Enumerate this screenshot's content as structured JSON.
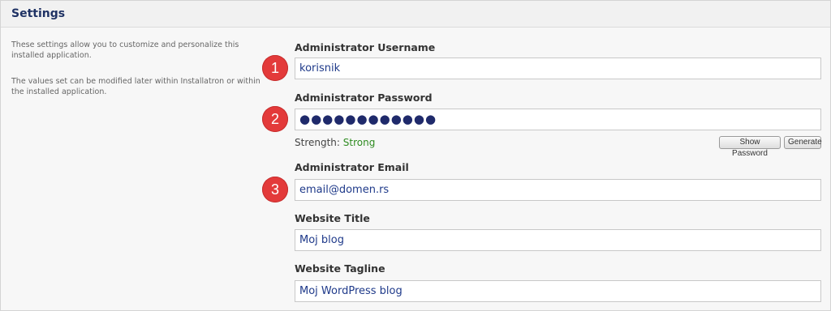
{
  "panel": {
    "title": "Settings"
  },
  "description": {
    "paragraph_1": "These settings allow you to customize and personalize this installed application.",
    "paragraph_2": "The values set can be modified later within Installatron or within the installed application."
  },
  "fields": {
    "username": {
      "label": "Administrator Username",
      "value": "korisnik",
      "marker": "1"
    },
    "password": {
      "label": "Administrator Password",
      "value": "●●●●●●●●●●●●",
      "marker": "2"
    },
    "email": {
      "label": "Administrator Email",
      "value": "email@domen.rs",
      "marker": "3"
    },
    "title": {
      "label": "Website Title",
      "value": "Moj blog"
    },
    "tagline": {
      "label": "Website Tagline",
      "value": "Moj WordPress blog"
    }
  },
  "password_tools": {
    "strength_label": "Strength:",
    "strength_value": "Strong",
    "show_password_label": "Show Password",
    "generate_label": "Generate"
  },
  "colors": {
    "title": "#1f3264",
    "marker": "#e33a3a",
    "strength_strong": "#2e8b20",
    "field_text": "#1f3a8a"
  }
}
